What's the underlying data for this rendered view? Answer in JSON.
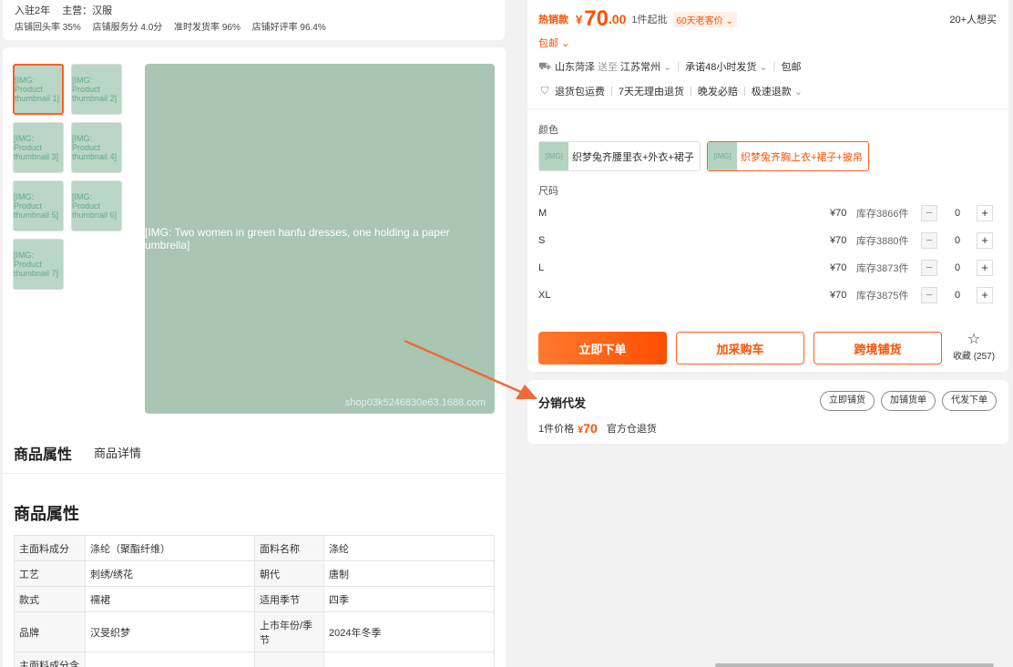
{
  "shop": {
    "years": "入驻2年",
    "main_business": "主营：汉服",
    "stats": [
      "店铺回头率 35%",
      "店铺服务分 4.0分",
      "准时发货率 96%",
      "店铺好评率 96.4%"
    ]
  },
  "gallery": {
    "watermark": "shop03k5246830e63.1688.com"
  },
  "tabs": [
    "商品属性",
    "商品详情"
  ],
  "attributes": {
    "title": "商品属性",
    "rows": [
      [
        "主面料成分",
        "涤纶（聚酯纤维）",
        "面料名称",
        "涤纶"
      ],
      [
        "工艺",
        "刺绣/绣花",
        "朝代",
        "唐制"
      ],
      [
        "款式",
        "襦裙",
        "适用季节",
        "四季"
      ],
      [
        "品牌",
        "汉旻织梦",
        "上市年份/季节",
        "2024年冬季"
      ],
      [
        "主面料成分含",
        "",
        "",
        ""
      ]
    ]
  },
  "price": {
    "hot_label": "热销款",
    "symbol": "¥",
    "integer": "70",
    "decimal": ".00",
    "moq": "1件起批",
    "return_badge": "60天老客价",
    "want": "20+人想买",
    "free_ship": "包邮"
  },
  "shipping": {
    "from": "山东菏泽",
    "to_word": "送至",
    "to": "江苏常州",
    "promise": "承诺48小时发货",
    "free": "包邮"
  },
  "services": [
    "退货包运费",
    "7天无理由退货",
    "晚发必赔",
    "极速退款"
  ],
  "color": {
    "label": "颜色",
    "options": [
      "织梦兔齐腰里衣+外衣+裙子",
      "织梦兔齐胸上衣+裙子+披帛"
    ]
  },
  "size": {
    "label": "尺码",
    "rows": [
      {
        "name": "M",
        "price": "¥70",
        "stock": "库存3866件",
        "qty": "0"
      },
      {
        "name": "S",
        "price": "¥70",
        "stock": "库存3880件",
        "qty": "0"
      },
      {
        "name": "L",
        "price": "¥70",
        "stock": "库存3873件",
        "qty": "0"
      },
      {
        "name": "XL",
        "price": "¥70",
        "stock": "库存3875件",
        "qty": "0"
      }
    ],
    "minus": "−",
    "plus": "+"
  },
  "actions": {
    "order": "立即下单",
    "cart": "加采购车",
    "cross": "跨境铺货",
    "fav": "收藏 (257)"
  },
  "distribution": {
    "title": "分销代发",
    "buttons": [
      "立即铺货",
      "加铺货单",
      "代发下单"
    ],
    "unit_label": "1件价格",
    "symbol": "¥",
    "price": "70",
    "note": "官方仓退货"
  },
  "colors": {
    "accent": "#ff5000"
  }
}
